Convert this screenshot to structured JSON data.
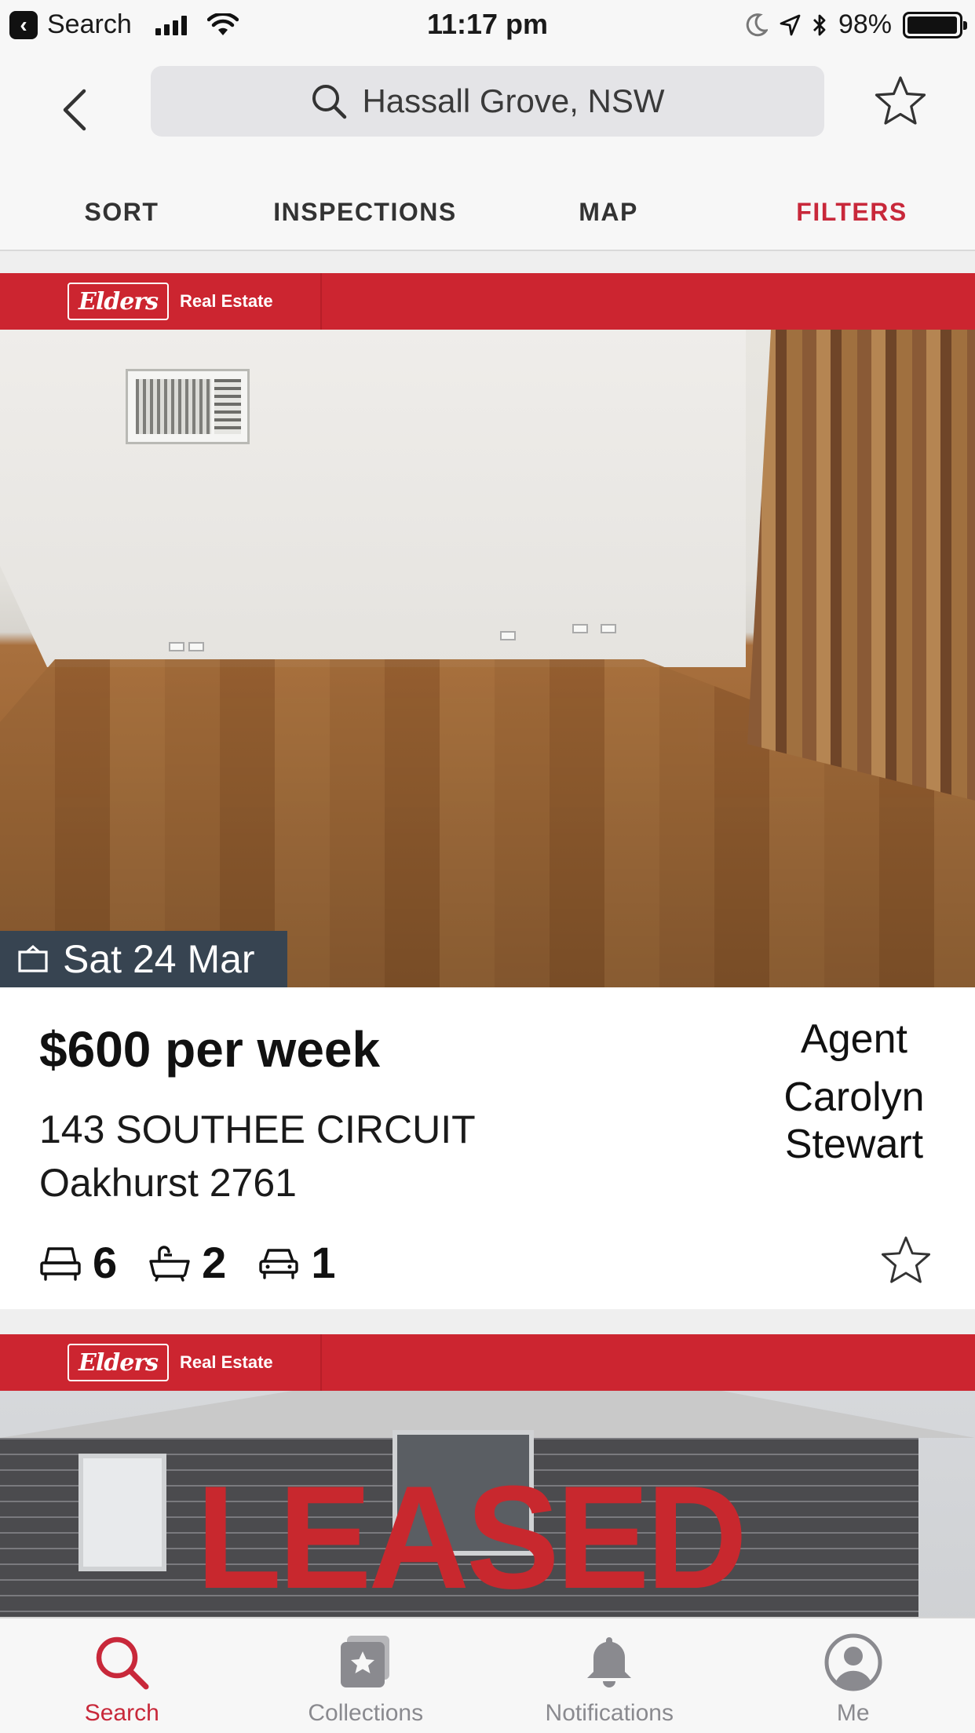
{
  "status_bar": {
    "back_app": "Search",
    "time": "11:17 pm",
    "battery": "98%",
    "battery_level": 0.98
  },
  "nav": {
    "search_text": "Hassall Grove, NSW",
    "tabs": [
      {
        "label": "SORT",
        "active": false
      },
      {
        "label": "INSPECTIONS",
        "active": false
      },
      {
        "label": "MAP",
        "active": false
      },
      {
        "label": "FILTERS",
        "active": true
      }
    ]
  },
  "listings": [
    {
      "agency": {
        "logo": "Elders",
        "name": "Real Estate"
      },
      "inspection": "Sat 24 Mar",
      "price": "$600 per week",
      "address_line1": "143 SOUTHEE CIRCUIT",
      "address_line2": "Oakhurst 2761",
      "agent_role": "Agent",
      "agent_name": "Carolyn Stewart",
      "bedrooms": "6",
      "bathrooms": "2",
      "parking": "1"
    },
    {
      "agency": {
        "logo": "Elders",
        "name": "Real Estate"
      },
      "overlay_text": "LEASED"
    }
  ],
  "tab_bar": [
    {
      "label": "Search",
      "icon": "search-icon",
      "active": true
    },
    {
      "label": "Collections",
      "icon": "collections-icon",
      "active": false
    },
    {
      "label": "Notifications",
      "icon": "bell-icon",
      "active": false
    },
    {
      "label": "Me",
      "icon": "person-icon",
      "active": false
    }
  ],
  "colors": {
    "accent": "#c8283a",
    "agency_red": "#cc2530",
    "inspection_badge": "#374451"
  }
}
